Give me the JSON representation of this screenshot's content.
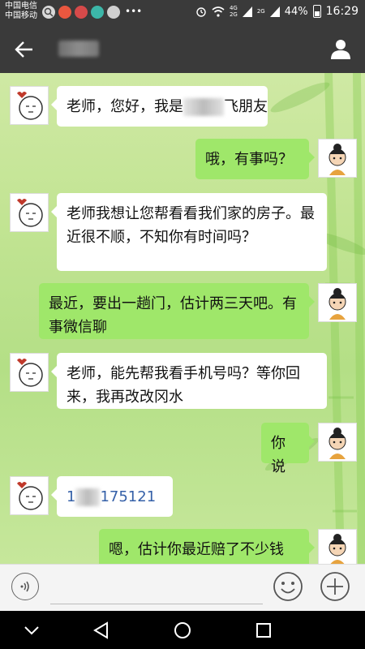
{
  "status_bar": {
    "carrier_1": "中国电信",
    "carrier_2": "中国移动",
    "network_a": "4G",
    "network_b": "2G",
    "network_c": "2G",
    "battery": "44%",
    "time": "16:29"
  },
  "messages": [
    {
      "side": "left",
      "parts": [
        "老师，您好，我是",
        "飞朋友"
      ]
    },
    {
      "side": "right",
      "text": "哦，有事吗？"
    },
    {
      "side": "left",
      "text": "老师我想让您帮看看我们家的房子。最近很不顺，不知你有时间吗？"
    },
    {
      "side": "right",
      "text": "最近，要出一趟门，估计两三天吧。有事微信聊"
    },
    {
      "side": "left",
      "text": "老师，能先帮我看手机号吗？等你回来，我再改改冈水"
    },
    {
      "side": "right",
      "text": "你说"
    },
    {
      "side": "left",
      "phone_prefix": "1",
      "phone_suffix": "175121"
    },
    {
      "side": "right",
      "text": "嗯，估计你最近赔了不少钱"
    }
  ],
  "icons": {
    "back": "arrow-left-icon",
    "profile": "person-icon",
    "voice": "voice-icon",
    "emoji": "smiley-icon",
    "plus": "plus-icon"
  },
  "colors": {
    "bar": "#3a3a3a",
    "bubble_right": "#9fe76a",
    "bubble_left": "#ffffff",
    "chat_bg": "#c2e493"
  }
}
